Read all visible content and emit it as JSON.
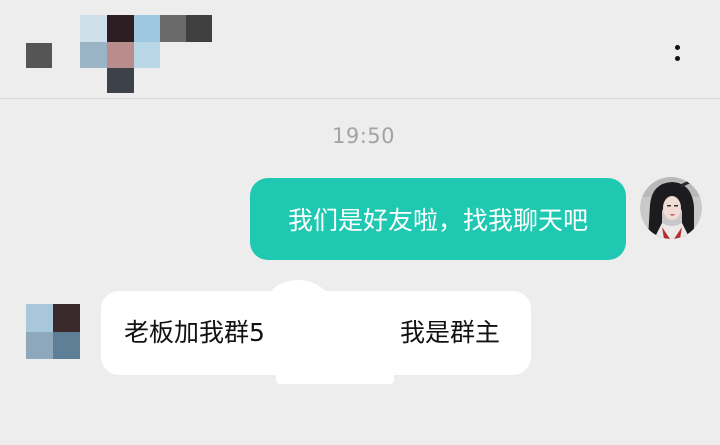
{
  "header": {
    "back_icon": "back-icon",
    "more_icon": "more-dots-icon",
    "contact_name_redacted": true
  },
  "chat": {
    "timestamp": "19:50",
    "messages": [
      {
        "direction": "outgoing",
        "text": "我们是好友啦，找我聊天吧",
        "bubble_color": "#1fc9b1"
      },
      {
        "direction": "incoming",
        "text_visible_start": "老板加我群5",
        "text_visible_end": "我是群主",
        "partially_redacted": true,
        "bubble_color": "#ffffff"
      }
    ]
  },
  "colors": {
    "background": "#ededed",
    "accent": "#1fc9b1",
    "timestamp": "#a3a3a3"
  }
}
